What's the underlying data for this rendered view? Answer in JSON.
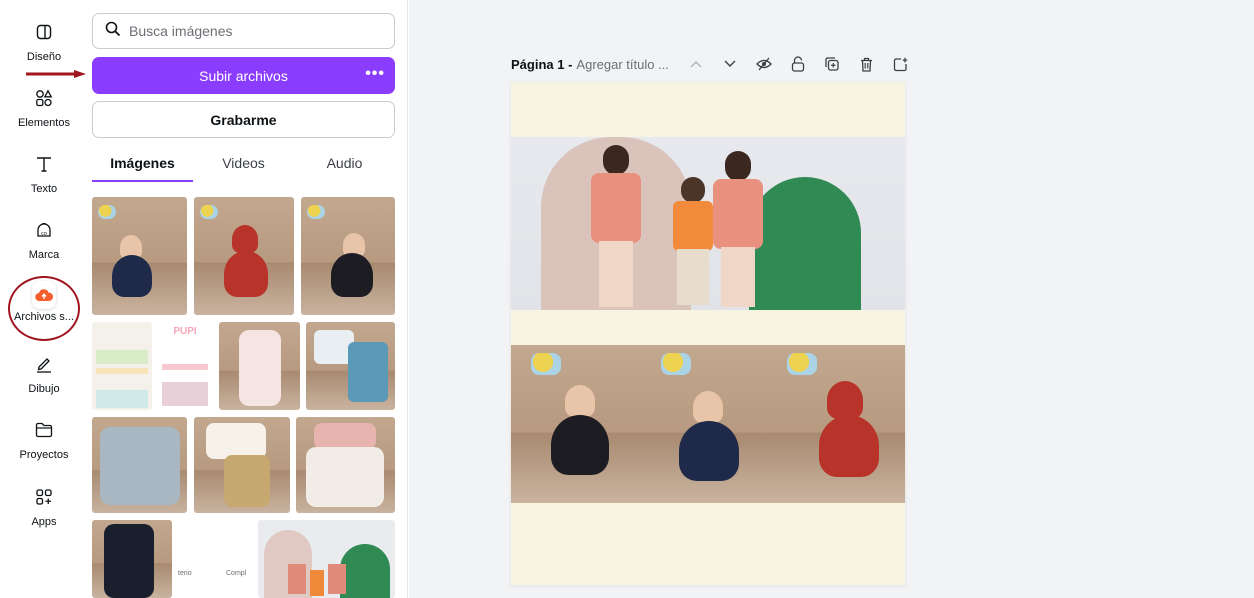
{
  "rail": {
    "items": [
      {
        "label": "Diseño",
        "icon": "layout-icon"
      },
      {
        "label": "Elementos",
        "icon": "shapes-icon"
      },
      {
        "label": "Texto",
        "icon": "text-icon"
      },
      {
        "label": "Marca",
        "icon": "brand-icon"
      },
      {
        "label": "Archivos s...",
        "icon": "cloud-upload-icon"
      },
      {
        "label": "Dibujo",
        "icon": "draw-icon"
      },
      {
        "label": "Proyectos",
        "icon": "folder-icon"
      },
      {
        "label": "Apps",
        "icon": "apps-icon"
      }
    ],
    "active_index": 4
  },
  "panel": {
    "search_placeholder": "Busca imágenes",
    "upload_label": "Subir archivos",
    "upload_more": "•••",
    "record_label": "Grabarme",
    "tabs": [
      {
        "label": "Imágenes",
        "active": true
      },
      {
        "label": "Videos",
        "active": false
      },
      {
        "label": "Audio",
        "active": false
      }
    ],
    "thumb_caption_left": "terio",
    "thumb_caption_right": "Compl"
  },
  "canvas": {
    "page_name": "Página 1 -",
    "page_title_placeholder": "Agregar título ..."
  },
  "colors": {
    "accent": "#8b3dff",
    "page_bg": "#f7f4e1",
    "annotation": "#a01520"
  }
}
